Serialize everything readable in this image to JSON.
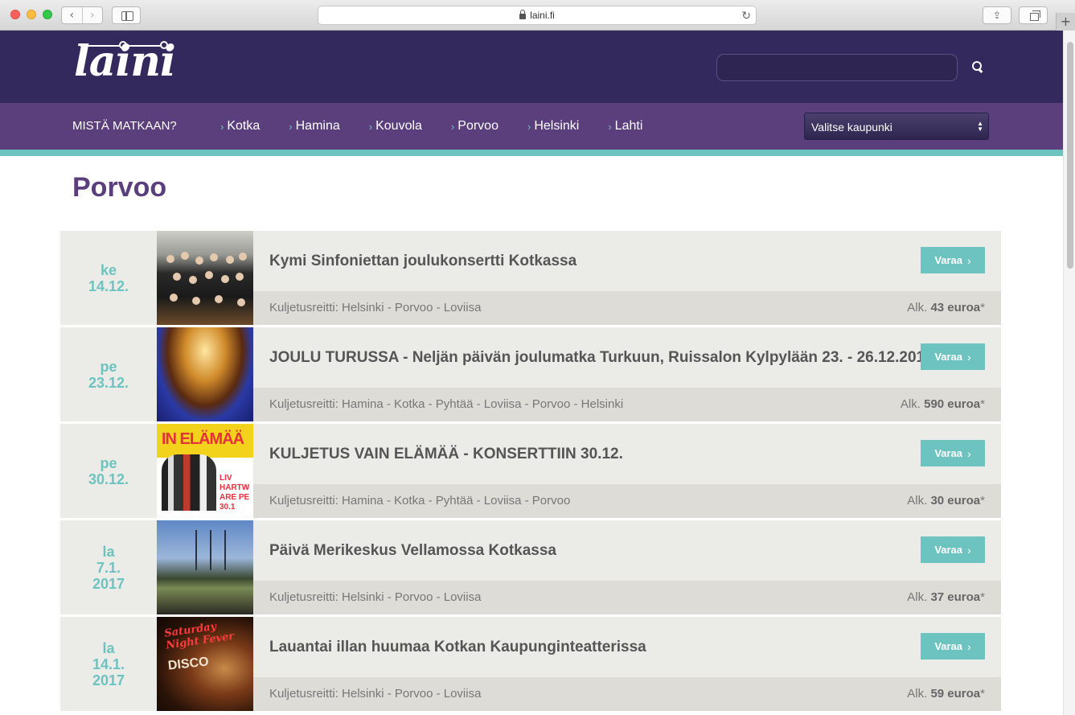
{
  "browser": {
    "url": "laini.fi",
    "back_glyph": "‹",
    "forward_glyph": "›",
    "reload_glyph": "↻",
    "share_glyph": "⇪",
    "new_tab_glyph": "+"
  },
  "header": {
    "logo_text": "laini",
    "search_placeholder": ""
  },
  "nav": {
    "title": "MISTÄ MATKAAN?",
    "links": [
      "Kotka",
      "Hamina",
      "Kouvola",
      "Porvoo",
      "Helsinki",
      "Lahti"
    ],
    "chevron": "›",
    "select_value": "Valitse kaupunki",
    "select_arrow_up": "▲",
    "select_arrow_down": "▼"
  },
  "page": {
    "title": "Porvoo"
  },
  "events": [
    {
      "day": "ke",
      "date": "14.12.",
      "year": "",
      "title": "Kymi Sinfoniettan joulukonsertti Kotkassa",
      "route": "Kuljetusreitti: Helsinki - Porvoo - Loviisa",
      "price_prefix": "Alk.",
      "price": "43 euroa",
      "price_suffix": "*",
      "button": "Varaa",
      "image": "orchestra-photo"
    },
    {
      "day": "pe",
      "date": "23.12.",
      "year": "",
      "title": "JOULU TURUSSA - Neljän päivän joulumatka Turkuun, Ruissalon Kylpylään 23. - 26.12.2016",
      "route": "Kuljetusreitti: Hamina - Kotka - Pyhtää - Loviisa - Porvoo - Helsinki",
      "price_prefix": "Alk.",
      "price": "590 euroa",
      "price_suffix": "*",
      "button": "Varaa",
      "image": "spa-pool-photo"
    },
    {
      "day": "pe",
      "date": "30.12.",
      "year": "",
      "title": "KULJETUS VAIN ELÄMÄÄ - KONSERTTIIN 30.12.",
      "route": "Kuljetusreitti: Hamina - Kotka - Pyhtää - Loviisa - Porvoo",
      "price_prefix": "Alk.",
      "price": "30 euroa",
      "price_suffix": "*",
      "button": "Varaa",
      "image": "concert-poster",
      "image_text": "IN ELÄMÄÄ",
      "image_side_text": "LIV HARTW ARE PE 30.1"
    },
    {
      "day": "la",
      "date": "7.1.",
      "year": "2017",
      "title": "Päivä Merikeskus Vellamossa Kotkassa",
      "route": "Kuljetusreitti: Helsinki - Porvoo - Loviisa",
      "price_prefix": "Alk.",
      "price": "37 euroa",
      "price_suffix": "*",
      "button": "Varaa",
      "image": "museum-building-photo"
    },
    {
      "day": "la",
      "date": "14.1.",
      "year": "2017",
      "title": "Lauantai illan huumaa Kotkan Kaupunginteatterissa",
      "route": "Kuljetusreitti: Helsinki - Porvoo - Loviisa",
      "price_prefix": "Alk.",
      "price": "59 euroa",
      "price_suffix": "*",
      "button": "Varaa",
      "image": "disco-theatre-poster",
      "image_text": "Saturday Night Fever",
      "image_side_text": "DISCO"
    }
  ]
}
